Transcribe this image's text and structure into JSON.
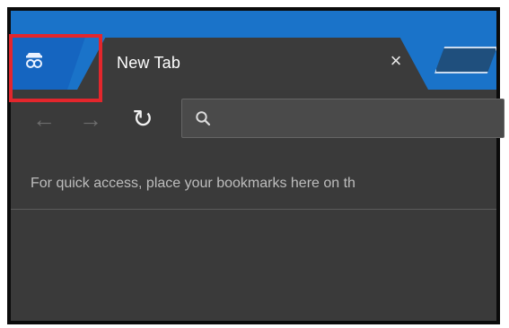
{
  "colors": {
    "tabstrip_blue": "#1a73c9",
    "incognito_blue": "#1565c0",
    "chrome_dark": "#3a3a3a",
    "tab_dark": "#3b3b3b",
    "highlight_red": "#e3262c"
  },
  "tabs": [
    {
      "title": "New Tab",
      "close_symbol": "×"
    }
  ],
  "toolbar": {
    "back_symbol": "←",
    "forward_symbol": "→",
    "reload_symbol": "↻",
    "search_placeholder": ""
  },
  "bookmarks_bar": {
    "message": "For quick access, place your bookmarks here on th"
  },
  "icons": {
    "incognito": "incognito-icon",
    "close": "close-icon",
    "new_tab": "new-tab-icon",
    "back": "back-arrow-icon",
    "forward": "forward-arrow-icon",
    "reload": "reload-icon",
    "search": "search-icon"
  }
}
